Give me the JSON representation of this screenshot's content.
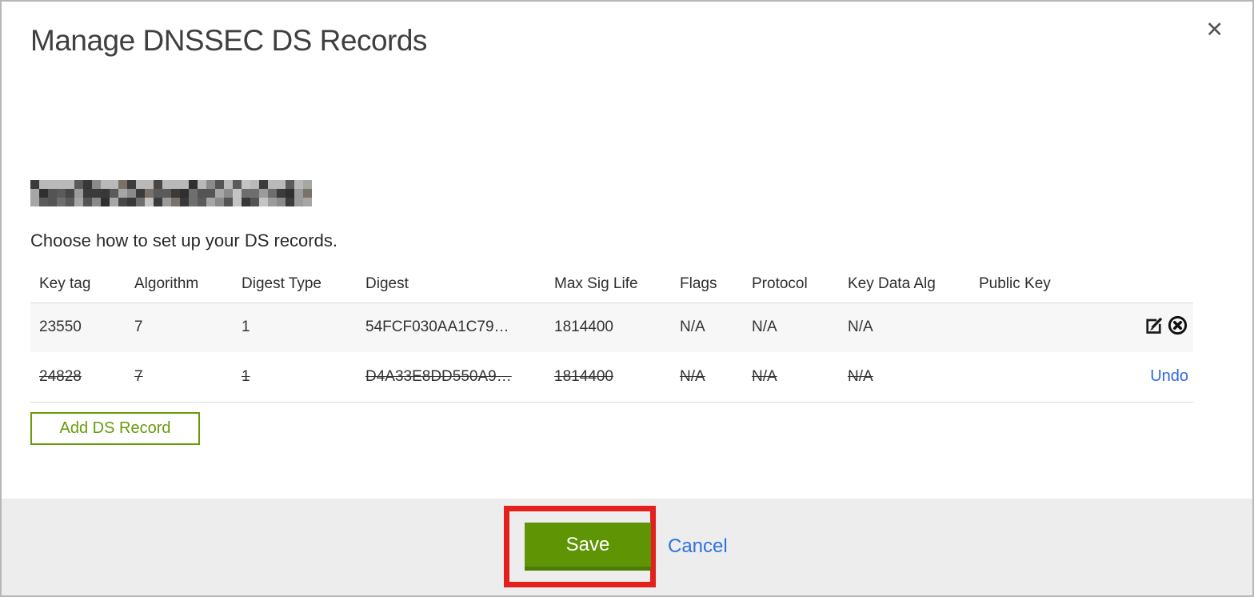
{
  "dialog": {
    "title": "Manage DNSSEC DS Records",
    "instruction": "Choose how to set up your DS records."
  },
  "icons": {
    "close": "✕"
  },
  "table": {
    "columns": [
      "Key tag",
      "Algorithm",
      "Digest Type",
      "Digest",
      "Max Sig Life",
      "Flags",
      "Protocol",
      "Key Data Alg",
      "Public Key"
    ],
    "rows": [
      {
        "key_tag": "23550",
        "algorithm": "7",
        "digest_type": "1",
        "digest": "54FCF030AA1C79…",
        "max_sig_life": "1814400",
        "flags": "N/A",
        "protocol": "N/A",
        "key_data_alg": "N/A",
        "public_key": "",
        "state": "current"
      },
      {
        "key_tag": "24828",
        "algorithm": "7",
        "digest_type": "1",
        "digest": "D4A33E8DD550A9…",
        "max_sig_life": "1814400",
        "flags": "N/A",
        "protocol": "N/A",
        "key_data_alg": "N/A",
        "public_key": "",
        "state": "deleted",
        "undo_label": "Undo"
      }
    ]
  },
  "buttons": {
    "add_ds_record": "Add DS Record",
    "save": "Save",
    "cancel": "Cancel"
  },
  "colors": {
    "save_green": "#5f9505",
    "outline_green": "#679b09",
    "link_blue": "#2f72dd",
    "annotation_red": "#e3201b"
  }
}
